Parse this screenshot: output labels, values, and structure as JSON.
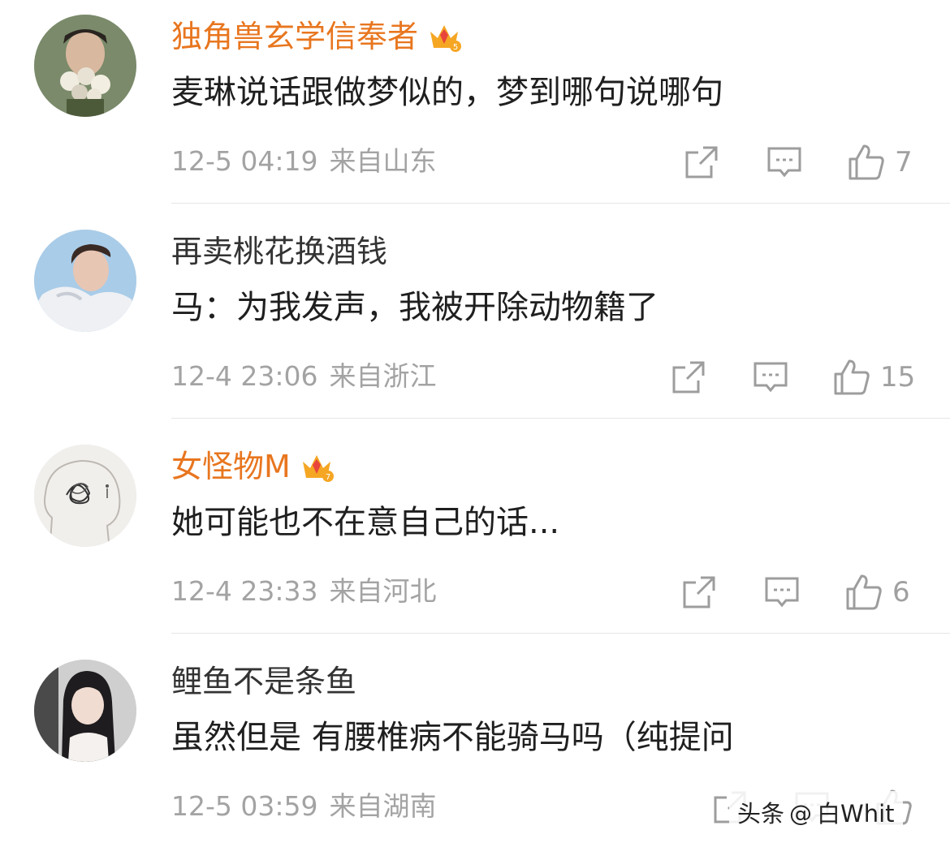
{
  "comments": [
    {
      "username": "独角兽玄学信奉者",
      "text": "麦琳说话跟做梦似的，梦到哪句说哪句",
      "time": "12-5 04:19",
      "location": "来自山东",
      "likes": "7"
    },
    {
      "username": "再卖桃花换酒钱",
      "text": "马：为我发声，我被开除动物籍了",
      "time": "12-4 23:06",
      "location": "来自浙江",
      "likes": "15"
    },
    {
      "username": "女怪物M",
      "text": "她可能也不在意自己的话...",
      "time": "12-4 23:33",
      "location": "来自河北",
      "likes": "6"
    },
    {
      "username": "鲤鱼不是条鱼",
      "text": "虽然但是 有腰椎病不能骑马吗（纯提问",
      "time": "12-5 03:59",
      "location": "来自湖南",
      "likes": ""
    }
  ],
  "watermark": {
    "label": "头条",
    "handle": "白Whit"
  },
  "colors": {
    "vip_name": "#e8761f",
    "name": "#333333",
    "meta": "#a3a3a3",
    "crown": "#f5a623"
  },
  "icons": [
    "share-icon",
    "reply-icon",
    "like-icon",
    "vip-crown-icon"
  ]
}
